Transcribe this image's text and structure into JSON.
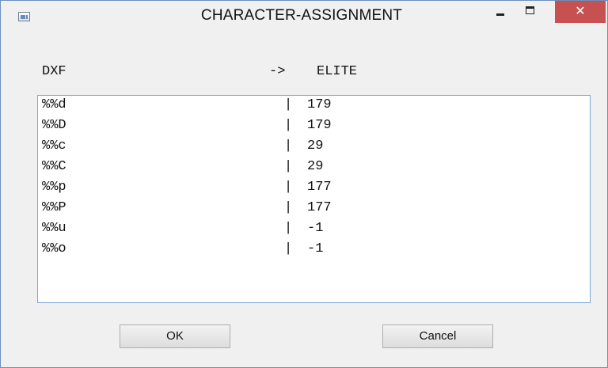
{
  "window": {
    "title": "CHARACTER-ASSIGNMENT",
    "close_glyph": "✕"
  },
  "header": {
    "left": "DXF",
    "arrow": "->",
    "right": "ELITE"
  },
  "list": {
    "separator": "|",
    "rows": [
      {
        "dxf": "%%d",
        "elite": "179"
      },
      {
        "dxf": "%%D",
        "elite": "179"
      },
      {
        "dxf": "%%c",
        "elite": "29"
      },
      {
        "dxf": "%%C",
        "elite": "29"
      },
      {
        "dxf": "%%p",
        "elite": "177"
      },
      {
        "dxf": "%%P",
        "elite": "177"
      },
      {
        "dxf": "%%u",
        "elite": "-1"
      },
      {
        "dxf": "%%o",
        "elite": "-1"
      }
    ]
  },
  "buttons": {
    "ok": "OK",
    "cancel": "Cancel"
  },
  "colors": {
    "close_button": "#c75050",
    "list_border": "#7aa7da"
  }
}
